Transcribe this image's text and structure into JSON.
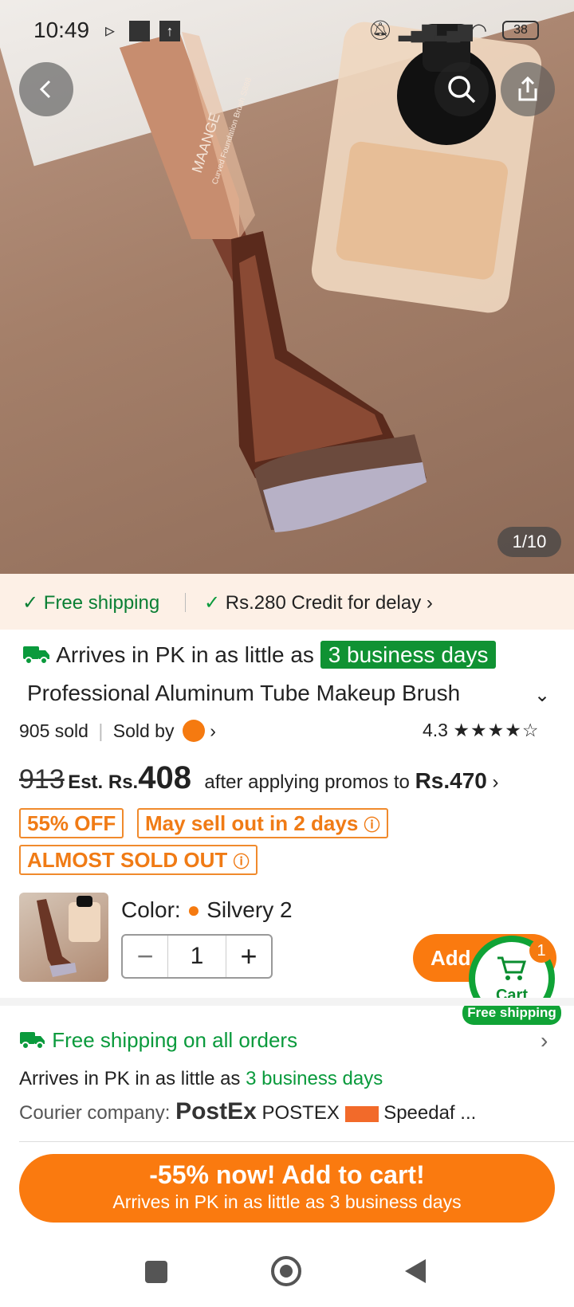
{
  "status_bar": {
    "time": "10:49",
    "battery": "38"
  },
  "gallery": {
    "counter": "1/10",
    "brand_text": "MAANGE",
    "brush_sub_text": "Curved Foundation Brush S888"
  },
  "promo_strip": {
    "free_shipping": "Free shipping",
    "credit": "Rs.280 Credit for delay"
  },
  "product": {
    "arrive_prefix": "Arrives in PK in as little as",
    "arrive_days": "3 business days",
    "title": "Professional Aluminum Tube Makeup Brush",
    "sold": "905 sold",
    "sold_by": "Sold by",
    "rating": "4.3",
    "original_price": "913",
    "est_label": "Est. Rs.",
    "est_price": "408",
    "after_promos": "after applying promos to",
    "promo_price": "Rs.470",
    "tags": [
      "55% OFF",
      "May sell out in 2 days",
      "ALMOST SOLD OUT"
    ]
  },
  "variant": {
    "color_label": "Color:",
    "color_value": "Silvery 2",
    "quantity": "1",
    "add_label": "Add t"
  },
  "cart_widget": {
    "label": "Cart",
    "badge": "1",
    "free_shipping": "Free shipping"
  },
  "shipping": {
    "headline": "Free shipping on all orders",
    "arrive_prefix": "Arrives in PK in as little as",
    "arrive_days": "3 business days",
    "courier_label": "Courier company:",
    "courier_logo": "PostEx",
    "courier_1": "POSTEX",
    "courier_2_logo": "Speedaf express",
    "courier_2": "Speedaf ..."
  },
  "cta": {
    "line1": "-55% now! Add to cart!",
    "line2": "Arrives in PK in as little as 3 business days"
  },
  "colors": {
    "orange": "#fa7a0f",
    "green": "#0a9a3c",
    "cart_green": "#10a336"
  }
}
